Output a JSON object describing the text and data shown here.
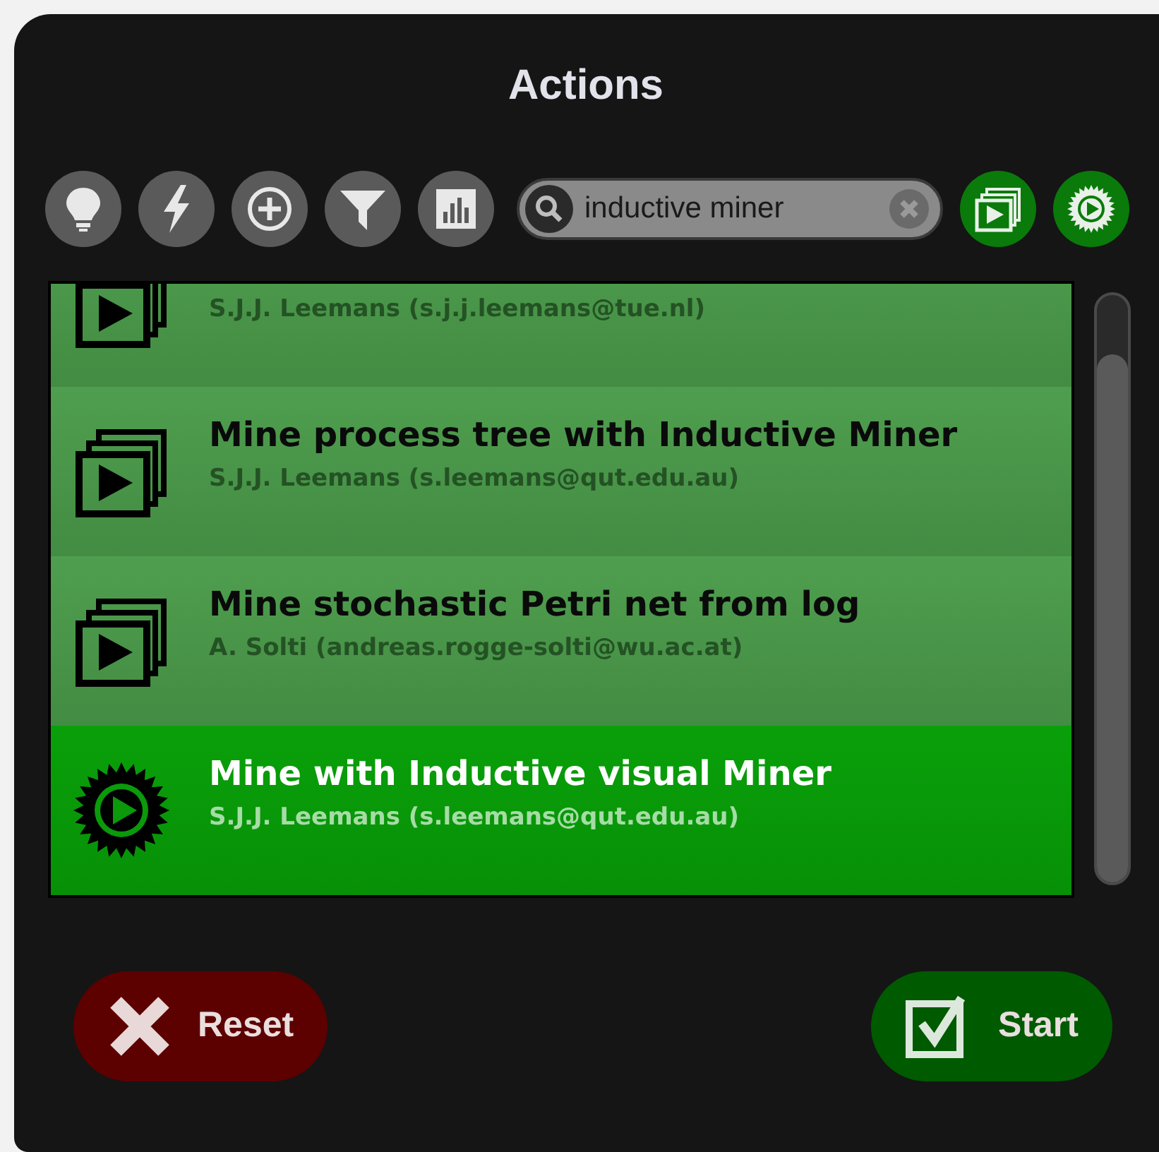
{
  "title": "Actions",
  "search": {
    "value": "inductive miner"
  },
  "actions": [
    {
      "kind": "multi",
      "author": "S.J.J. Leemans (s.j.j.leemans@tue.nl)",
      "selected": false
    },
    {
      "kind": "multi",
      "title": "Mine process tree with Inductive Miner",
      "author": "S.J.J. Leemans (s.leemans@qut.edu.au)",
      "selected": false
    },
    {
      "kind": "multi",
      "title": "Mine stochastic Petri net from log",
      "author": "A. Solti (andreas.rogge-solti@wu.ac.at)",
      "selected": false
    },
    {
      "kind": "gear",
      "title": "Mine with Inductive visual Miner",
      "author": "S.J.J. Leemans (s.leemans@qut.edu.au)",
      "selected": true
    }
  ],
  "buttons": [
    {
      "kind": "reset",
      "label": "Reset"
    },
    {
      "kind": "start",
      "label": "Start"
    }
  ]
}
